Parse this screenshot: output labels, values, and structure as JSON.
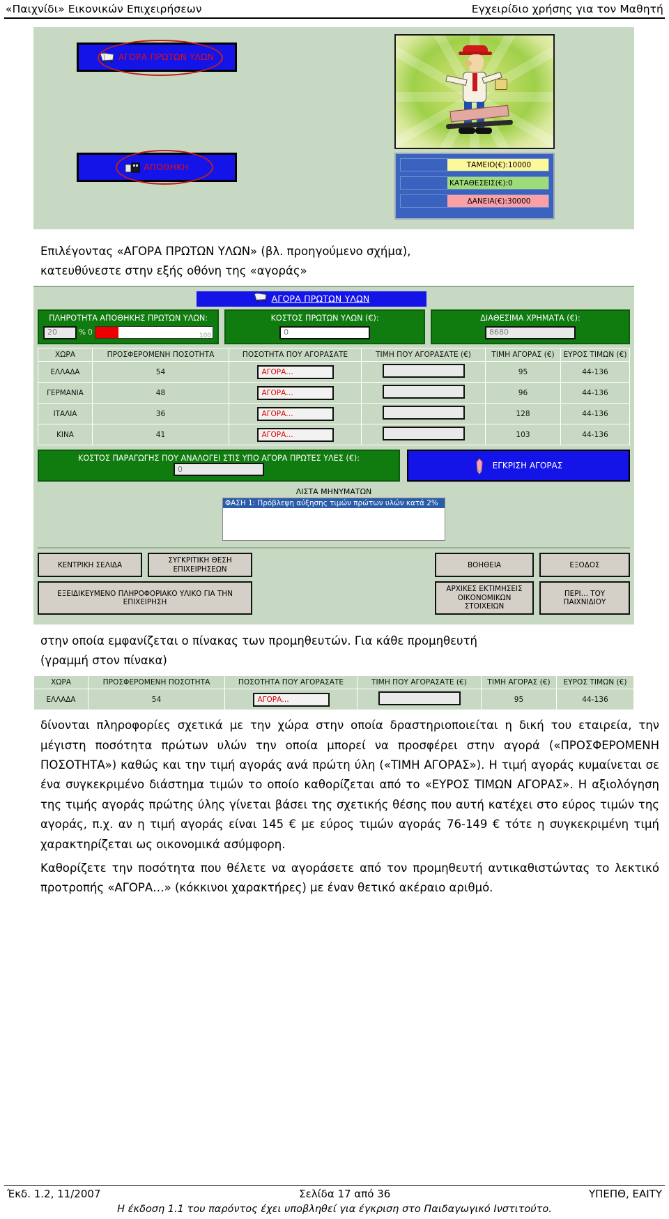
{
  "header": {
    "left": "«Παιχνίδι» Εικονικών Επιχειρήσεων",
    "right": "Εγχειρίδιο χρήσης για τον Μαθητή"
  },
  "shot1": {
    "nav_buttons": [
      {
        "label": "ΑΓΟΡΑ ΠΡΩΤΩΝ ΥΛΩΝ",
        "icon": "cart-icon",
        "highlighted": true
      },
      {
        "label": "ΑΠΟΘΗΚΗ",
        "icon": "warehouse-icon",
        "highlighted": true
      }
    ],
    "money": [
      {
        "label": "ΤΑΜΕΙΟ(€):10000",
        "color": "#fdf89a"
      },
      {
        "label": "ΚΑΤΑΘΕΣΕΙΣ(€):0",
        "color": "#9ddc78"
      },
      {
        "label": "ΔΑΝΕΙΑ(€):30000",
        "color": "#fba0a6"
      }
    ]
  },
  "paragraphs": {
    "p1_line1": "Επιλέγοντας  «ΑΓΟΡΑ  ΠΡΩΤΩΝ  ΥΛΩΝ»  (βλ.  προηγούμενο  σχήμα),",
    "p1_line2": "κατευθύνεστε στην εξής οθόνη της «αγοράς»",
    "p2_line1": "στην οποία εμφανίζεται ο πίνακας των προμηθευτών. Για κάθε προμηθευτή",
    "p2_line2": "(γραμμή στον πίνακα)",
    "p3": "δίνονται πληροφορίες σχετικά με την χώρα στην οποία δραστηριοποιείται η δική του εταιρεία, την μέγιστη ποσότητα πρώτων υλών την οποία μπορεί να προσφέρει στην αγορά («ΠΡΟΣΦΕΡΟΜΕΝΗ ΠΟΣΟΤΗΤΑ») καθώς και την τιμή αγοράς ανά πρώτη ύλη («ΤΙΜΗ ΑΓΟΡΑΣ»). Η τιμή αγοράς κυμαίνεται σε ένα συγκεκριμένο διάστημα τιμών το οποίο καθορίζεται από το «ΕΥΡΟΣ ΤΙΜΩΝ ΑΓΟΡΑΣ». Η αξιολόγηση της τιμής αγοράς πρώτης ύλης γίνεται βάσει της σχετικής θέσης που αυτή κατέχει στο εύρος τιμών της αγοράς, π.χ. αν η τιμή αγοράς είναι 145 € με εύρος τιμών αγοράς 76-149 € τότε η συγκεκριμένη τιμή χαρακτηρίζεται ως οικονομικά ασύμφορη.",
    "p4": "Καθορίζετε την ποσότητα που θέλετε να αγοράσετε από τον προμηθευτή αντικαθιστώντας το λεκτικό προτροπής «ΑΓΟΡΑ…» (κόκκινοι χαρακτήρες) με έναν θετικό ακέραιο αριθμό."
  },
  "app": {
    "title": "ΑΓΟΡΑ ΠΡΩΤΩΝ ΥΛΩΝ",
    "title_icon": "cart-icon",
    "fullness": {
      "label": "ΠΛΗΡΟΤΗΤΑ ΑΠΟΘΗΚΗΣ ΠΡΩΤΩΝ ΥΛΩΝ:",
      "value": "20",
      "unit": "%",
      "min": "0",
      "max": "100",
      "fill_percent": 20
    },
    "cost_raw": {
      "label": "ΚΟΣΤΟΣ ΠΡΩΤΩΝ ΥΛΩΝ (€):",
      "value": "0"
    },
    "available_money": {
      "label": "ΔΙΑΘΕΣΙΜΑ ΧΡΗΜΑΤΑ (€):",
      "value": "8680"
    },
    "table": {
      "headers": [
        "ΧΩΡΑ",
        "ΠΡΟΣΦΕΡΟΜΕΝΗ ΠΟΣΟΤΗΤΑ",
        "ΠΟΣΟΤΗΤΑ ΠΟΥ ΑΓΟΡΑΣΑΤΕ",
        "ΤΙΜΗ ΠΟΥ ΑΓΟΡΑΣΑΤΕ (€)",
        "ΤΙΜΗ ΑΓΟΡΑΣ (€)",
        "ΕΥΡΟΣ ΤΙΜΩΝ (€)"
      ],
      "buy_prompt": "ΑΓΟΡΑ…",
      "rows": [
        {
          "country": "ΕΛΛΑΔΑ",
          "offered": "54",
          "buy": "ΑΓΟΡΑ…",
          "paid": "",
          "price": "95",
          "range": "44-136"
        },
        {
          "country": "ΓΕΡΜΑΝΙΑ",
          "offered": "48",
          "buy": "ΑΓΟΡΑ…",
          "paid": "",
          "price": "96",
          "range": "44-136"
        },
        {
          "country": "ΙΤΑΛΙΑ",
          "offered": "36",
          "buy": "ΑΓΟΡΑ…",
          "paid": "",
          "price": "128",
          "range": "44-136"
        },
        {
          "country": "ΚΙΝΑ",
          "offered": "41",
          "buy": "ΑΓΟΡΑ…",
          "paid": "",
          "price": "103",
          "range": "44-136"
        }
      ]
    },
    "production_cost": {
      "label": "ΚΟΣΤΟΣ ΠΑΡΑΓΩΓΗΣ ΠΟΥ ΑΝΑΛΟΓΕΙ ΣΤΙΣ ΥΠΟ ΑΓΟΡΑ ΠΡΩΤΕΣ ΥΛΕΣ (€):",
      "value": "0"
    },
    "approve_button": {
      "label": "ΕΓΚΡΙΣΗ ΑΓΟΡΑΣ",
      "icon": "pen-icon"
    },
    "messages": {
      "title": "ΛΙΣΤΑ ΜΗΝΥΜΑΤΩΝ",
      "items": [
        "ΦΑΣΗ 1: Πρόβλεψη αύξησης τιμών πρώτων υλών κατά 2%"
      ]
    },
    "buttons": [
      "ΚΕΝΤΡΙΚΗ ΣΕΛΙΔΑ",
      "ΣΥΓΚΡΙΤΙΚΗ ΘΕΣΗ ΕΠΙΧΕΙΡΗΣΕΩΝ",
      "ΒΟΗΘΕΙΑ",
      "ΕΞΟΔΟΣ",
      "ΕΞΕΙΔΙΚΕΥΜΕΝΟ ΠΛΗΡΟΦΟΡΙΑΚΟ ΥΛΙΚΟ ΓΙΑ ΤΗΝ ΕΠΙΧΕΙΡΗΣΗ",
      "ΑΡΧΙΚΕΣ ΕΚΤΙΜΗΣΕΙΣ ΟΙΚΟΝΟΜΙΚΩΝ ΣΤΟΙΧΕΙΩΝ",
      "ΠΕΡΙ… ΤΟΥ ΠΑΙΧΝΙΔΙΟΥ"
    ]
  },
  "footer": {
    "left": "Έκδ. 1.2, 11/2007",
    "center": "Σελίδα 17 από 36",
    "right": "ΥΠΕΠΘ, ΕΑΙΤΥ",
    "note": "Η έκδοση 1.1 του παρόντος έχει υποβληθεί για έγκριση στο Παιδαγωγικό Ινστιτούτο."
  },
  "colors": {
    "app_bg": "#c7d9c2",
    "green_box": "#107c10",
    "blue_button": "#1414e8",
    "highlight_red": "#c02020",
    "buy_text_red": "#dd0000"
  }
}
